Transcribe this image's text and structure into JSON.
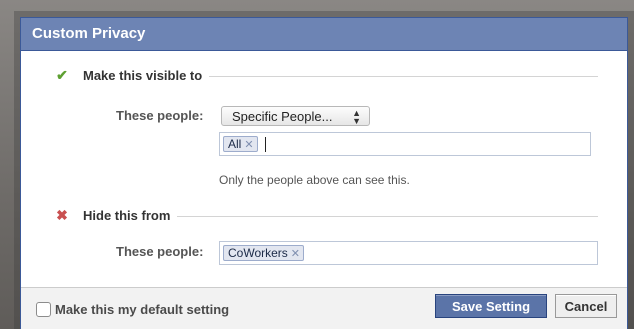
{
  "dialog": {
    "title": "Custom Privacy"
  },
  "visible_section": {
    "icon": "check-icon",
    "title": "Make this visible to",
    "people_label": "These people:",
    "select_value": "Specific People...",
    "tokens": [
      "All"
    ],
    "hint": "Only the people above can see this."
  },
  "hide_section": {
    "icon": "x-icon",
    "title": "Hide this from",
    "people_label": "These people:",
    "tokens": [
      "CoWorkers"
    ]
  },
  "footer": {
    "default_label": "Make this my default setting",
    "default_checked": false,
    "save_label": "Save Setting",
    "cancel_label": "Cancel"
  },
  "colors": {
    "title_bar": "#6d84b4",
    "primary_button": "#5b74a8",
    "check": "#5ea032",
    "x": "#c95050"
  }
}
